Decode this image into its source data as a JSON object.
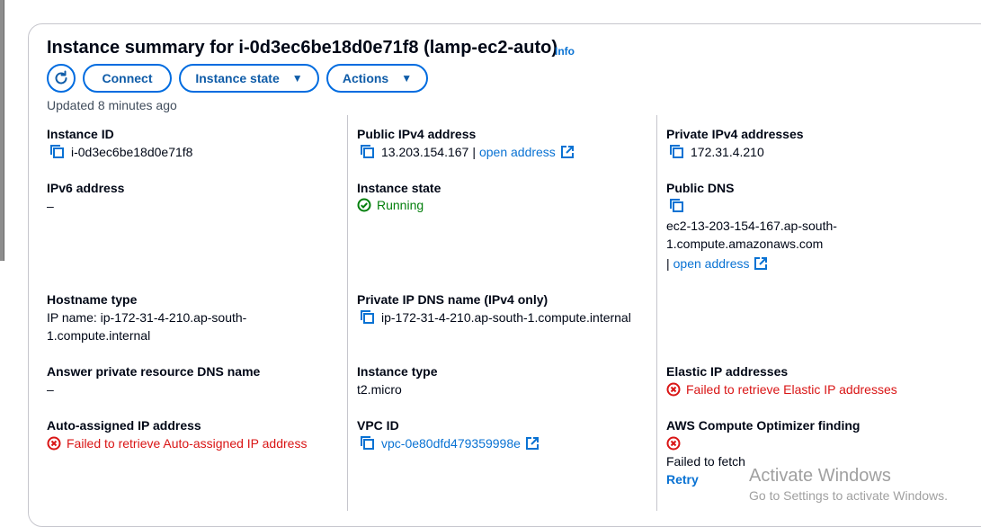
{
  "header": {
    "title": "Instance summary for i-0d3ec6be18d0e71f8 (lamp-ec2-auto)",
    "info": "Info",
    "updated": "Updated 8 minutes ago"
  },
  "toolbar": {
    "connect_label": "Connect",
    "instance_state_label": "Instance state",
    "actions_label": "Actions"
  },
  "details": {
    "instance_id": {
      "label": "Instance ID",
      "value": "i-0d3ec6be18d0e71f8"
    },
    "public_ipv4": {
      "label": "Public IPv4 address",
      "value": "13.203.154.167",
      "sep": "|",
      "link": "open address"
    },
    "private_ipv4": {
      "label": "Private IPv4 addresses",
      "value": "172.31.4.210"
    },
    "ipv6": {
      "label": "IPv6 address",
      "value": "–"
    },
    "instance_state": {
      "label": "Instance state",
      "value": "Running"
    },
    "public_dns": {
      "label": "Public DNS",
      "value_line1": "ec2-13-203-154-167.ap-south-",
      "value_line2": "1.compute.amazonaws.com",
      "sep": "|",
      "link": "open address"
    },
    "hostname_type": {
      "label": "Hostname type",
      "value_line1": "IP name: ip-172-31-4-210.ap-south-",
      "value_line2": "1.compute.internal"
    },
    "private_ip_dns": {
      "label": "Private IP DNS name (IPv4 only)",
      "value": "ip-172-31-4-210.ap-south-1.compute.internal"
    },
    "answer_private_dns": {
      "label": "Answer private resource DNS name",
      "value": "–"
    },
    "instance_type": {
      "label": "Instance type",
      "value": "t2.micro"
    },
    "elastic_ip": {
      "label": "Elastic IP addresses",
      "value": "Failed to retrieve Elastic IP addresses"
    },
    "auto_assigned_ip": {
      "label": "Auto-assigned IP address",
      "value": "Failed to retrieve Auto-assigned IP address"
    },
    "vpc_id": {
      "label": "VPC ID",
      "value": "vpc-0e80dfd479359998e"
    },
    "compute_optimizer": {
      "label": "AWS Compute Optimizer finding",
      "value": "Failed to fetch",
      "retry": "Retry"
    }
  },
  "watermark": {
    "line1": "Activate Windows",
    "line2": "Go to Settings to activate Windows."
  },
  "colors": {
    "link": "#0972d3",
    "error": "#d91515",
    "success": "#037f0c",
    "button_border": "#006ce0"
  },
  "icons": [
    "refresh-icon",
    "caret-down-icon",
    "copy-icon",
    "external-link-icon",
    "status-success-icon",
    "status-error-icon"
  ]
}
